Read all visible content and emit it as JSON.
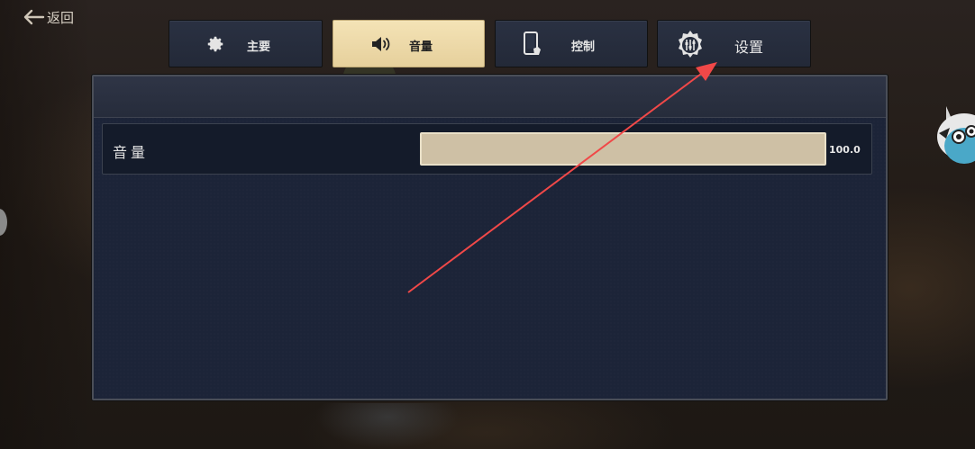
{
  "back": {
    "label": "返回"
  },
  "tabs": [
    {
      "label": "主要",
      "icon": "gear-icon",
      "active": false
    },
    {
      "label": "音量",
      "icon": "speaker-icon",
      "active": true
    },
    {
      "label": "控制",
      "icon": "phone-touch-icon",
      "active": false
    },
    {
      "label": "设置",
      "icon": "settings-sliders-icon",
      "active": false
    }
  ],
  "settings": {
    "volume": {
      "label": "音量",
      "value": "100.0",
      "level": 1.0
    }
  },
  "colors": {
    "active_tab": "#f0deb0",
    "tab_bg": "#262d3d",
    "panel_bg": "#1c2438",
    "slider": "#cec0a5",
    "annotation_arrow": "#f04848"
  }
}
